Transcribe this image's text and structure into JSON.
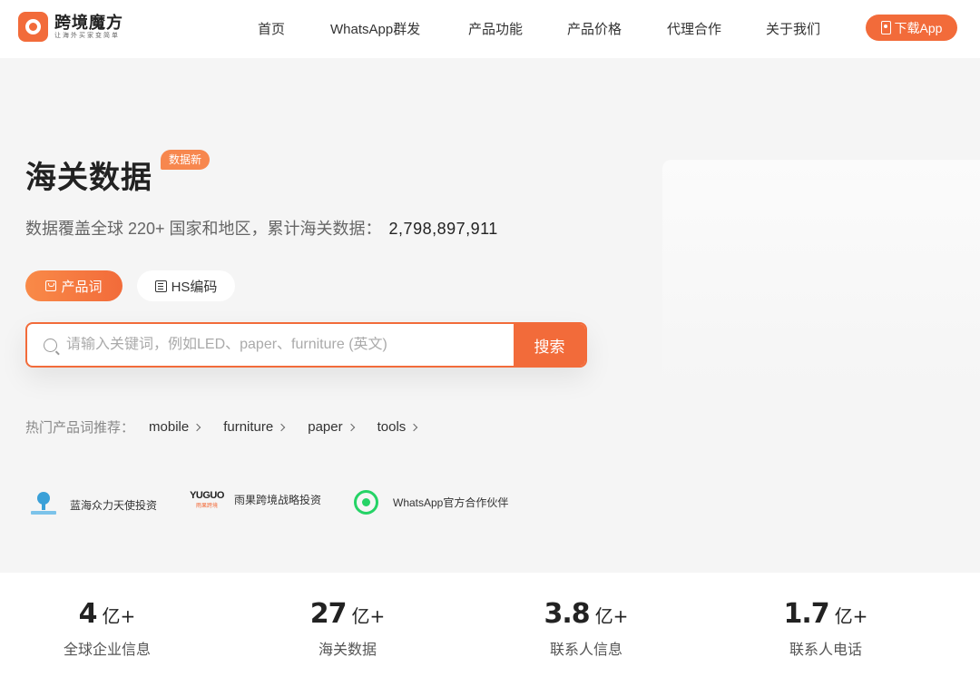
{
  "header": {
    "logo": {
      "name": "跨境魔方",
      "slogan": "让海外买家变简单"
    },
    "nav": [
      "首页",
      "WhatsApp群发",
      "产品功能",
      "产品价格",
      "代理合作",
      "关于我们"
    ],
    "download_label": "下载App"
  },
  "hero": {
    "title": "海关数据",
    "badge": "数据新",
    "subtitle": "数据覆盖全球 220+ 国家和地区，累计海关数据：",
    "count": "2,798,897,911",
    "tabs": [
      {
        "label": "产品词",
        "icon": "bag-icon",
        "active": true
      },
      {
        "label": "HS编码",
        "icon": "hs-code-icon",
        "active": false
      }
    ],
    "search": {
      "placeholder": "请输入关键词，例如LED、paper、furniture (英文)",
      "value": "",
      "button_label": "搜索"
    },
    "hot": {
      "label": "热门产品词推荐：",
      "items": [
        "mobile",
        "furniture",
        "paper",
        "tools"
      ]
    }
  },
  "partners": [
    {
      "name": "蓝海众力天使投资",
      "icon": "lanhai-logo"
    },
    {
      "name": "雨果跨境战略投资",
      "icon": "yuguo-logo",
      "logo_text": "YUGUO",
      "logo_sub": "雨果跨境"
    },
    {
      "name": "WhatsApp官方合作伙伴",
      "icon": "whatsapp-logo"
    }
  ],
  "stats": [
    {
      "value": "4",
      "unit": "亿+",
      "label": "全球企业信息"
    },
    {
      "value": "27",
      "unit": "亿+",
      "label": "海关数据"
    },
    {
      "value": "3.8",
      "unit": "亿+",
      "label": "联系人信息"
    },
    {
      "value": "1.7",
      "unit": "亿+",
      "label": "联系人电话"
    }
  ],
  "colors": {
    "accent": "#f26b3a",
    "whatsapp": "#25d366"
  }
}
